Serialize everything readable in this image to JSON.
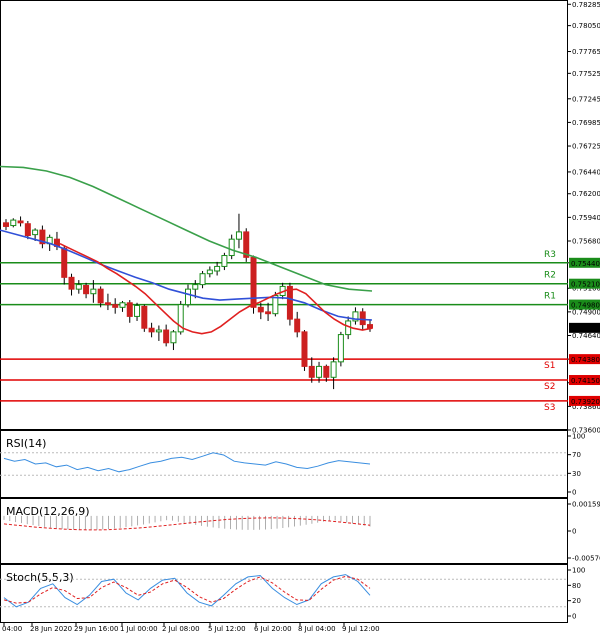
{
  "chart_data": {
    "type": "candlestick",
    "instrument_scale": "price",
    "price_axis": {
      "ticks": [
        "0.78285",
        "0.78050",
        "0.77765",
        "0.77525",
        "0.77245",
        "0.76985",
        "0.76725",
        "0.76440",
        "0.76200",
        "0.75940",
        "0.75680",
        "0.75440",
        "0.75160",
        "0.74900",
        "0.74640",
        "0.74380",
        "0.74120",
        "0.73860",
        "0.73600"
      ],
      "ylim": [
        0.736,
        0.7831
      ]
    },
    "time_axis": {
      "ticks": [
        "04:00",
        "28 Jun 2020",
        "29 Jun 16:00",
        "1 Jul 00:00",
        "2 Jul 08:00",
        "5 Jul 12:00",
        "6 Jul 20:00",
        "8 Jul 04:00",
        "9 Jul 12:00"
      ]
    },
    "levels": [
      {
        "name": "R3",
        "value": 0.7544,
        "tag": "0.75440",
        "color": "#1a8c1a"
      },
      {
        "name": "R2",
        "value": 0.7521,
        "tag": "0.75210",
        "color": "#1a8c1a"
      },
      {
        "name": "R1",
        "value": 0.7498,
        "tag": "0.74980",
        "color": "#1a8c1a"
      },
      {
        "name": "S1",
        "value": 0.7438,
        "tag": "0.74380",
        "color": "#e00000"
      },
      {
        "name": "S2",
        "value": 0.7415,
        "tag": "0.74150",
        "color": "#e00000"
      },
      {
        "name": "S3",
        "value": 0.7392,
        "tag": "0.73920",
        "color": "#e00000"
      }
    ],
    "current_price": {
      "value": 0.74724,
      "tag": "0.74724"
    },
    "candles": [
      [
        0.7588,
        0.7592,
        0.758,
        0.7584
      ],
      [
        0.7585,
        0.7593,
        0.7583,
        0.7591
      ],
      [
        0.759,
        0.7595,
        0.7584,
        0.7588
      ],
      [
        0.7587,
        0.759,
        0.757,
        0.7574
      ],
      [
        0.7575,
        0.7582,
        0.7568,
        0.758
      ],
      [
        0.758,
        0.7585,
        0.756,
        0.7565
      ],
      [
        0.7565,
        0.7575,
        0.7557,
        0.7572
      ],
      [
        0.757,
        0.7578,
        0.7558,
        0.7562
      ],
      [
        0.756,
        0.7563,
        0.752,
        0.7528
      ],
      [
        0.7528,
        0.7532,
        0.7508,
        0.7515
      ],
      [
        0.7515,
        0.7525,
        0.751,
        0.752
      ],
      [
        0.7519,
        0.7522,
        0.7505,
        0.751
      ],
      [
        0.751,
        0.7525,
        0.75,
        0.7515
      ],
      [
        0.7515,
        0.7518,
        0.7495,
        0.75
      ],
      [
        0.75,
        0.751,
        0.7492,
        0.7498
      ],
      [
        0.7498,
        0.7505,
        0.7488,
        0.7495
      ],
      [
        0.7495,
        0.7502,
        0.749,
        0.75
      ],
      [
        0.75,
        0.7503,
        0.7478,
        0.7485
      ],
      [
        0.7485,
        0.75,
        0.748,
        0.7497
      ],
      [
        0.7496,
        0.7498,
        0.7468,
        0.7472
      ],
      [
        0.7472,
        0.7478,
        0.7462,
        0.7468
      ],
      [
        0.7468,
        0.7475,
        0.7458,
        0.747
      ],
      [
        0.747,
        0.7476,
        0.7452,
        0.7456
      ],
      [
        0.7456,
        0.747,
        0.7448,
        0.7468
      ],
      [
        0.7468,
        0.7502,
        0.7465,
        0.7498
      ],
      [
        0.7498,
        0.752,
        0.7495,
        0.7515
      ],
      [
        0.7515,
        0.7525,
        0.7505,
        0.752
      ],
      [
        0.752,
        0.7535,
        0.7516,
        0.7532
      ],
      [
        0.7532,
        0.754,
        0.7528,
        0.7536
      ],
      [
        0.7535,
        0.7545,
        0.753,
        0.754
      ],
      [
        0.754,
        0.7555,
        0.7536,
        0.7552
      ],
      [
        0.7552,
        0.7575,
        0.7548,
        0.757
      ],
      [
        0.757,
        0.7598,
        0.756,
        0.7578
      ],
      [
        0.7578,
        0.7582,
        0.7545,
        0.755
      ],
      [
        0.755,
        0.7552,
        0.7488,
        0.7495
      ],
      [
        0.7495,
        0.75,
        0.7482,
        0.749
      ],
      [
        0.749,
        0.75,
        0.748,
        0.7488
      ],
      [
        0.7488,
        0.7512,
        0.7485,
        0.7508
      ],
      [
        0.7508,
        0.7522,
        0.7504,
        0.7518
      ],
      [
        0.7518,
        0.7522,
        0.7475,
        0.7482
      ],
      [
        0.7482,
        0.749,
        0.7462,
        0.7468
      ],
      [
        0.7468,
        0.747,
        0.7425,
        0.743
      ],
      [
        0.743,
        0.744,
        0.7412,
        0.7418
      ],
      [
        0.7418,
        0.7435,
        0.7412,
        0.743
      ],
      [
        0.743,
        0.7432,
        0.7413,
        0.7418
      ],
      [
        0.7418,
        0.744,
        0.7405,
        0.7435
      ],
      [
        0.7435,
        0.7468,
        0.743,
        0.7465
      ],
      [
        0.7465,
        0.7485,
        0.746,
        0.748
      ],
      [
        0.748,
        0.7495,
        0.7476,
        0.749
      ],
      [
        0.749,
        0.7494,
        0.747,
        0.7476
      ],
      [
        0.7476,
        0.7482,
        0.7468,
        0.7472
      ]
    ],
    "ma_fast": [
      0.7565,
      0.756,
      0.7555,
      0.755,
      0.7545,
      0.7538,
      0.7532,
      0.7525,
      0.7518,
      0.751,
      0.75,
      0.749,
      0.748,
      0.7472,
      0.7468,
      0.7466,
      0.7468,
      0.7474,
      0.7482,
      0.749,
      0.7496,
      0.75,
      0.7505,
      0.751,
      0.7514,
      0.7515,
      0.751,
      0.75,
      0.749,
      0.7482,
      0.7476,
      0.7472,
      0.747,
      0.7472
    ],
    "ma_mid": [
      0.758,
      0.7575,
      0.757,
      0.7565,
      0.7558,
      0.755,
      0.7542,
      0.7535,
      0.7528,
      0.7522,
      0.7515,
      0.751,
      0.7505,
      0.7503,
      0.7504,
      0.7505,
      0.7506,
      0.7505,
      0.75,
      0.7492,
      0.7485,
      0.7482,
      0.7481
    ],
    "ma_slow": [
      0.765,
      0.7649,
      0.7645,
      0.7638,
      0.7628,
      0.7616,
      0.7604,
      0.7592,
      0.758,
      0.7568,
      0.7558,
      0.755,
      0.754,
      0.753,
      0.752,
      0.7515,
      0.7513
    ],
    "indicators": [
      {
        "label": "RSI(14)",
        "axis": [
          "100",
          "70",
          "30",
          "0"
        ]
      },
      {
        "label": "MACD(12,26,9)",
        "axis": [
          "0.001599",
          "0",
          "-0.005765"
        ]
      },
      {
        "label": "Stoch(5,5,3)",
        "axis": [
          "100",
          "80",
          "20",
          "0"
        ]
      }
    ]
  }
}
